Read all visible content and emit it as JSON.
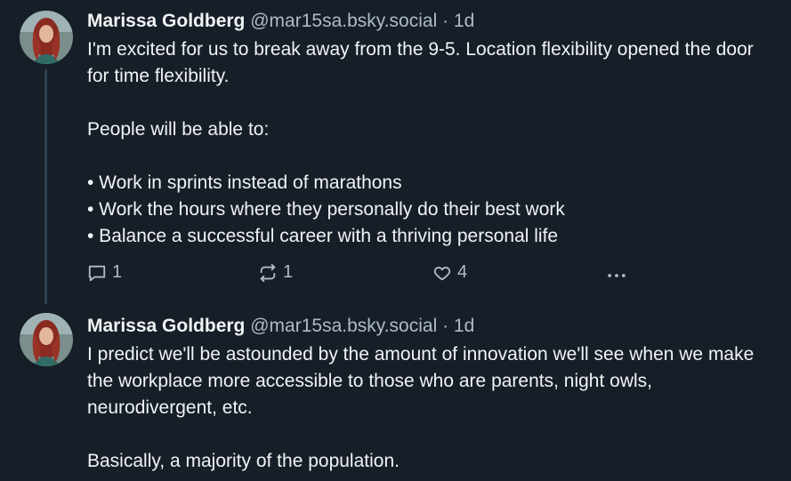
{
  "posts": [
    {
      "author_name": "Marissa Goldberg",
      "author_handle": "@mar15sa.bsky.social",
      "separator": "·",
      "time": "1d",
      "lines": [
        "I'm excited for us to break away from the 9-5. Location flexibility opened the door for time flexibility.",
        "",
        "People will be able to:",
        "",
        "• Work in sprints instead of marathons",
        "• Work the hours where they personally do their best work",
        "• Balance a successful career with a thriving personal life"
      ],
      "replies": "1",
      "reposts": "1",
      "likes": "4"
    },
    {
      "author_name": "Marissa Goldberg",
      "author_handle": "@mar15sa.bsky.social",
      "separator": "·",
      "time": "1d",
      "lines": [
        "I predict we'll be astounded by the amount of innovation we'll see when we make the workplace more accessible to those who are parents, night owls, neurodivergent, etc.",
        "",
        "Basically, a majority of the population."
      ]
    }
  ],
  "icons": {
    "reply": "reply-icon",
    "repost": "repost-icon",
    "like": "heart-icon",
    "more": "more-icon"
  },
  "colors": {
    "background": "#161e27",
    "text": "#f1f3f5",
    "muted": "#aebbc9",
    "thread_line": "#2e4052"
  }
}
